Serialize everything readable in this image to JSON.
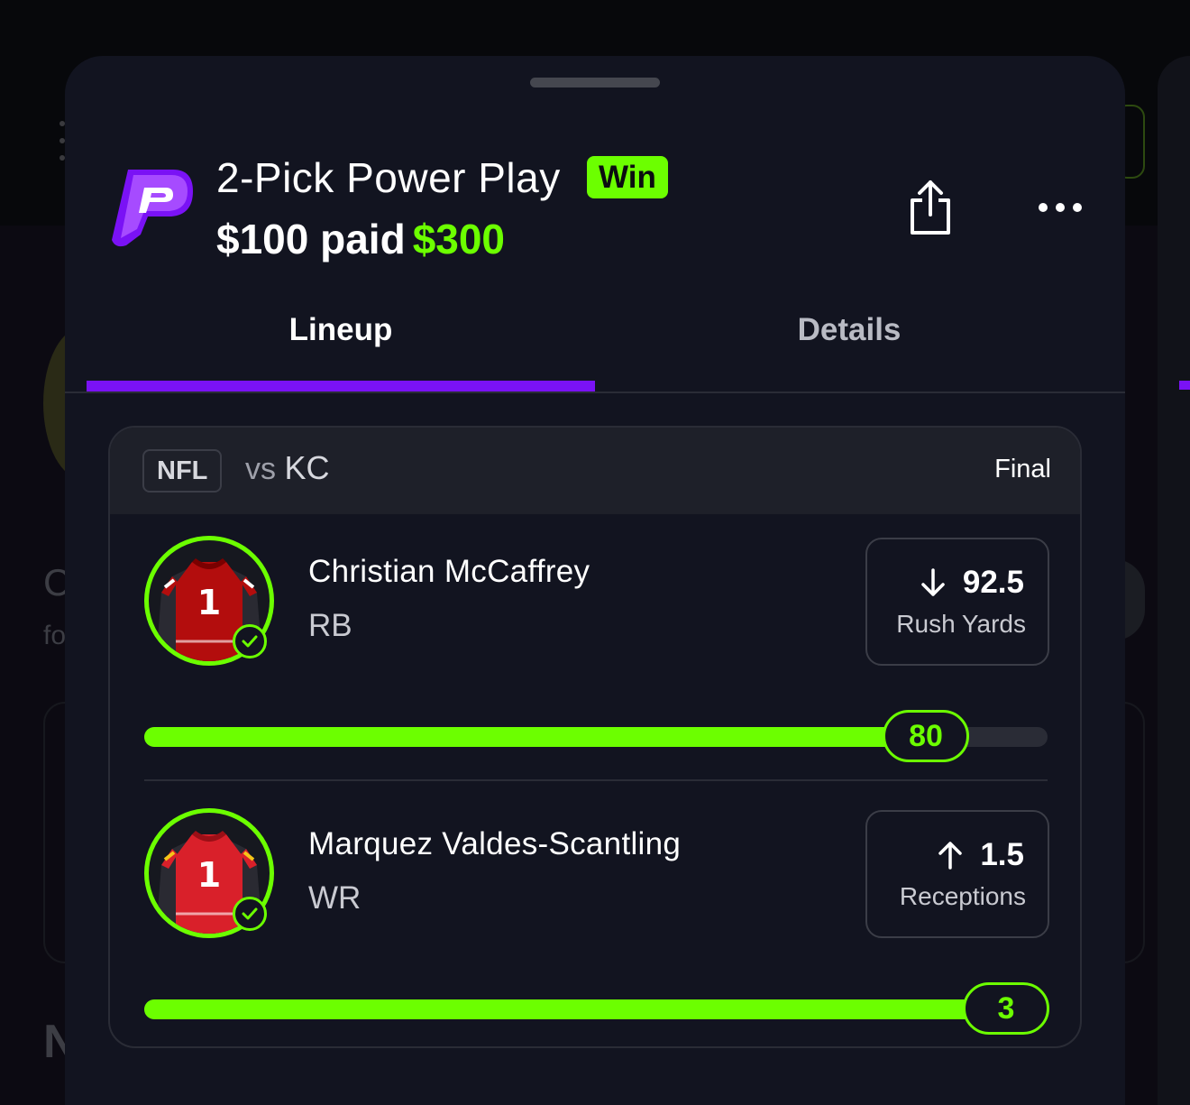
{
  "header": {
    "title": "2-Pick Power Play",
    "result_badge": "Win",
    "paid_label": "$100 paid",
    "won_amount": "$300"
  },
  "actions": {
    "share_icon": "share-icon",
    "more_icon": "more-dots-icon"
  },
  "tabs": [
    {
      "label": "Lineup",
      "active": true
    },
    {
      "label": "Details",
      "active": false
    }
  ],
  "game": {
    "league": "NFL",
    "vs_prefix": "vs",
    "opponent": "KC",
    "status": "Final"
  },
  "picks": [
    {
      "player": "Christian McCaffrey",
      "position": "RB",
      "direction": "down",
      "line": "92.5",
      "stat": "Rush Yards",
      "result": "80",
      "progress_fraction": 0.865,
      "jersey_color": "#b30d0d",
      "jersey_number": "1"
    },
    {
      "player": "Marquez Valdes-Scantling",
      "position": "WR",
      "direction": "up",
      "line": "1.5",
      "stat": "Receptions",
      "result": "3",
      "progress_fraction": 1.0,
      "jersey_color": "#d9202a",
      "jersey_number": "1"
    }
  ],
  "colors": {
    "accent_green": "#6cff00",
    "accent_purple": "#7a12f5",
    "background": "#121420"
  }
}
